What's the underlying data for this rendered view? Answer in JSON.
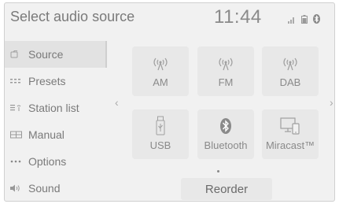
{
  "header": {
    "title": "Select audio source",
    "clock": "11:44"
  },
  "status_icons": [
    "signal-icon",
    "battery-icon",
    "bluetooth-icon"
  ],
  "sidebar": {
    "items": [
      {
        "label": "Source",
        "icon": "source-icon",
        "active": true
      },
      {
        "label": "Presets",
        "icon": "presets-icon",
        "active": false
      },
      {
        "label": "Station list",
        "icon": "station-list-icon",
        "active": false
      },
      {
        "label": "Manual",
        "icon": "manual-icon",
        "active": false
      },
      {
        "label": "Options",
        "icon": "options-icon",
        "active": false
      },
      {
        "label": "Sound",
        "icon": "sound-icon",
        "active": false
      }
    ]
  },
  "nav": {
    "prev": "‹",
    "next": "›"
  },
  "sources": [
    {
      "label": "AM",
      "icon": "radio-icon"
    },
    {
      "label": "FM",
      "icon": "radio-icon"
    },
    {
      "label": "DAB",
      "icon": "radio-icon"
    },
    {
      "label": "USB",
      "icon": "usb-icon"
    },
    {
      "label": "Bluetooth",
      "icon": "bluetooth-icon"
    },
    {
      "label": "Miracast™",
      "icon": "miracast-icon"
    }
  ],
  "reorder_label": "Reorder",
  "colors": {
    "background": "#f1f1f1",
    "tile": "#e8e8e8",
    "text": "#7a7a7a"
  }
}
